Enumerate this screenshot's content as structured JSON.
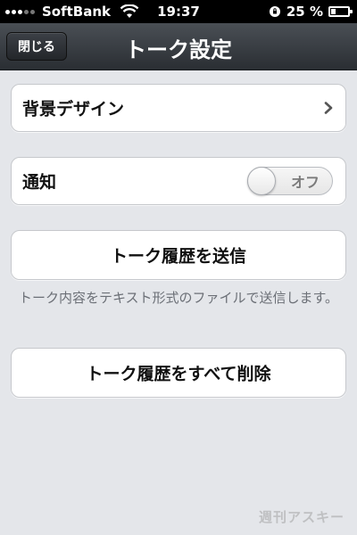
{
  "status_bar": {
    "carrier": "SoftBank",
    "time": "19:37",
    "battery": "25 %",
    "battery_level": 0.25
  },
  "nav": {
    "close_label": "閉じる",
    "title": "トーク設定"
  },
  "settings": {
    "background_design": "背景デザイン",
    "notification": "通知",
    "notification_toggle": "オフ",
    "send_history": "トーク履歴を送信",
    "send_history_note": "トーク内容をテキスト形式のファイルで送信します。",
    "delete_history": "トーク履歴をすべて削除"
  },
  "watermark": "週刊アスキー",
  "colors": {
    "background": "#e4e6ea",
    "navbar": "#2a2e33",
    "note_text": "#6b6f76"
  }
}
